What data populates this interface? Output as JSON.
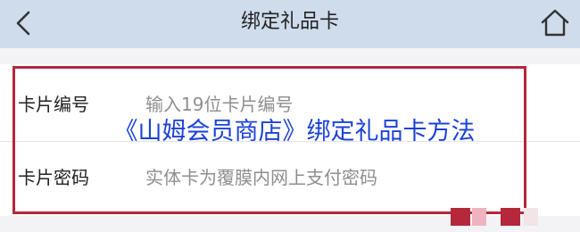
{
  "header": {
    "title": "绑定礼品卡",
    "back_icon": "chevron-left-icon",
    "home_icon": "home-icon",
    "background": "#cfdcec"
  },
  "form": {
    "card_number": {
      "label": "卡片编号",
      "placeholder": "输入19位卡片编号"
    },
    "card_password": {
      "label": "卡片密码",
      "placeholder": "实体卡为覆膜内网上支付密码"
    },
    "highlight_color": "#b7273a"
  },
  "overlay": {
    "caption": "《山姆会员商店》绑定礼品卡方法",
    "color": "#1c42d6"
  }
}
